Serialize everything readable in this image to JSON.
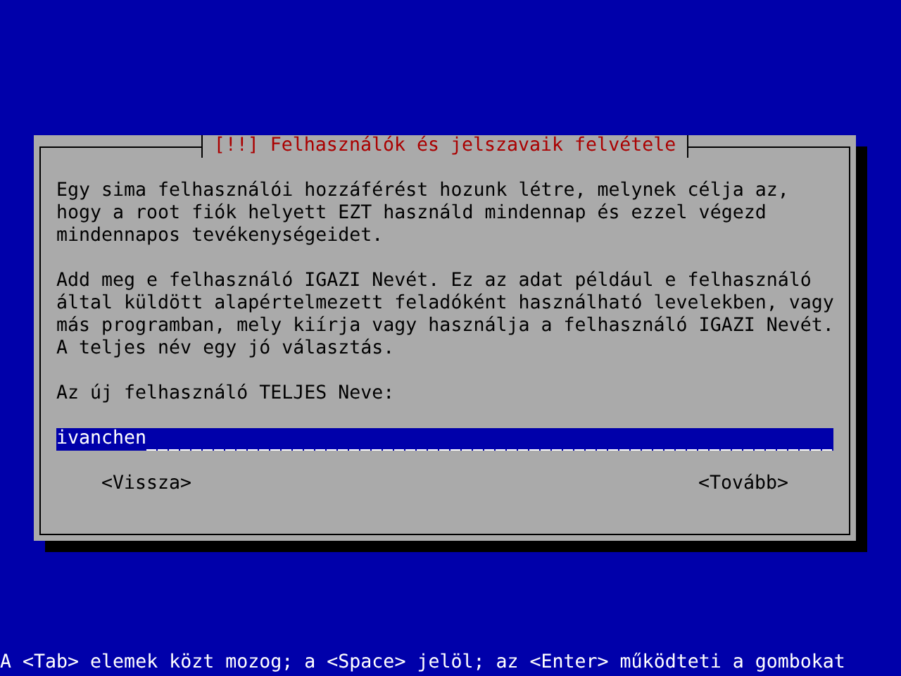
{
  "dialog": {
    "title": "[!!] Felhasználók és jelszavaik felvétele",
    "paragraphs": [
      "Egy sima felhasználói hozzáférést hozunk létre, melynek célja az,\nhogy a root fiók helyett EZT használd mindennap és ezzel végezd\nmindennapos tevékenységeidet.",
      "Add meg e felhasználó IGAZI Nevét. Ez az adat például e felhasználó\náltal küldött alapértelmezett feladóként használható levelekben, vagy\nmás programban, mely kiírja vagy használja a felhasználó IGAZI Nevét.\nA teljes név egy jó választás."
    ],
    "field": {
      "label": "Az új felhasználó TELJES Neve:",
      "value": "ivanchen"
    },
    "buttons": [
      {
        "label": "<Vissza>"
      },
      {
        "label": "<Tovább>"
      }
    ]
  },
  "status_bar": "A <Tab> elemek közt mozog; a <Space> jelöl; az <Enter> működteti a gombokat"
}
